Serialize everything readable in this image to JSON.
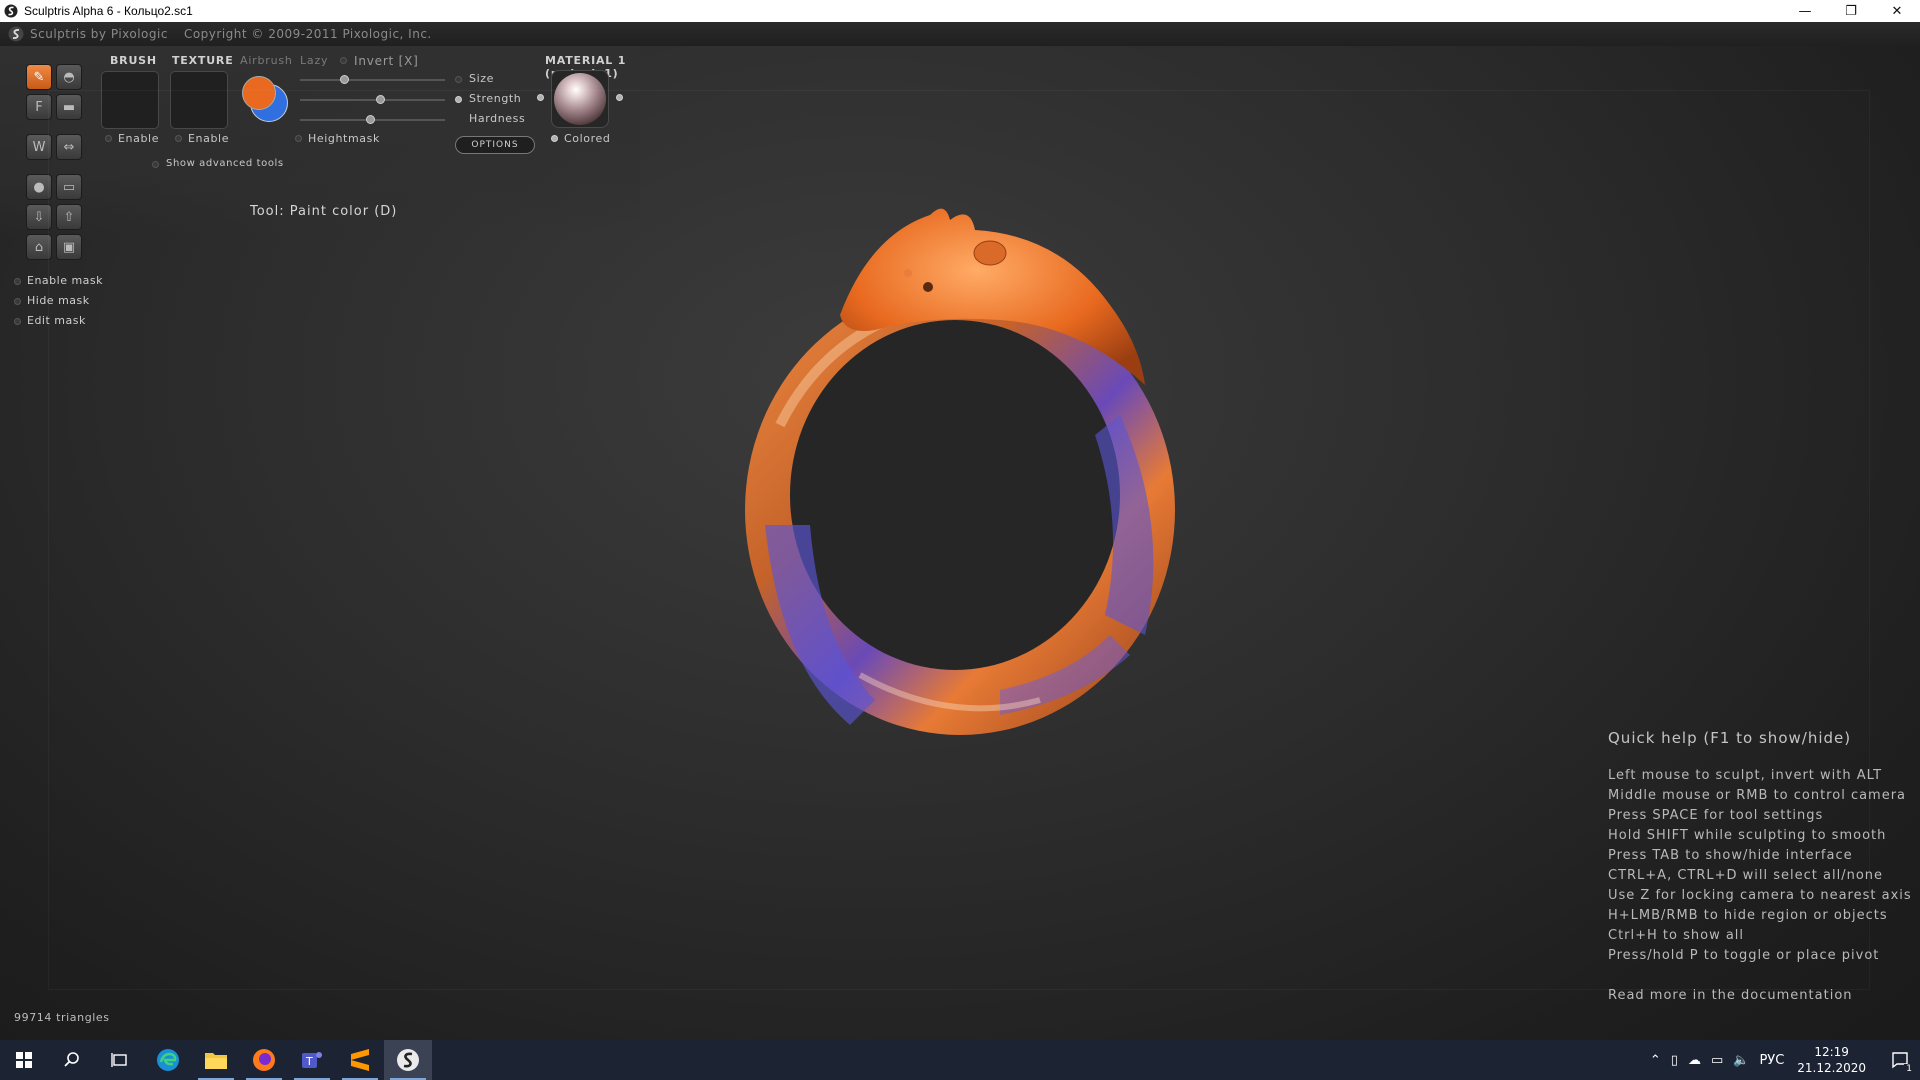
{
  "window": {
    "title": "Sculptris Alpha 6 - Кольцо2.sc1",
    "minimize": "—",
    "restore": "❐",
    "close": "✕"
  },
  "menu": {
    "app_name": "Sculptris by Pixologic",
    "copyright": "Copyright © 2009-2011 Pixologic, Inc."
  },
  "panel": {
    "brush_label": "BRUSH",
    "texture_label": "TEXTURE",
    "airbrush_label": "Airbrush",
    "lazy_label": "Lazy",
    "invert_label": "Invert [X]",
    "brush_enable": "Enable",
    "texture_enable": "Enable",
    "show_advanced": "Show advanced tools",
    "size_label": "Size",
    "strength_label": "Strength",
    "hardness_label": "Hardness",
    "heightmask_label": "Heightmask",
    "options_label": "OPTIONS",
    "material_label": "MATERIAL 1 (mshade1)",
    "colored_label": "Colored",
    "size_value": 0.3,
    "strength_value": 0.55,
    "hardness_value": 0.48,
    "primary_color": "#e8691f",
    "secondary_color": "#2f6fe0"
  },
  "tool_name": "Tool: Paint color (D)",
  "mask": {
    "enable": "Enable mask",
    "hide": "Hide mask",
    "edit": "Edit mask"
  },
  "help": {
    "title": "Quick help (F1 to show/hide)",
    "lines": [
      "Left mouse to sculpt, invert with ALT",
      "Middle mouse or RMB to control camera",
      "Press SPACE for tool settings",
      "Hold SHIFT while sculpting to smooth",
      "Press TAB to show/hide interface",
      "CTRL+A, CTRL+D will select all/none",
      "Use Z for locking camera to nearest axis",
      "H+LMB/RMB to hide region or objects",
      "Ctrl+H to show all",
      "Press/hold P to toggle or place pivot"
    ],
    "more": "Read more in the documentation"
  },
  "status": {
    "triangles": "99714 triangles"
  },
  "taskbar": {
    "lang": "РУС",
    "time": "12:19",
    "date": "21.12.2020",
    "notif_count": "1"
  }
}
